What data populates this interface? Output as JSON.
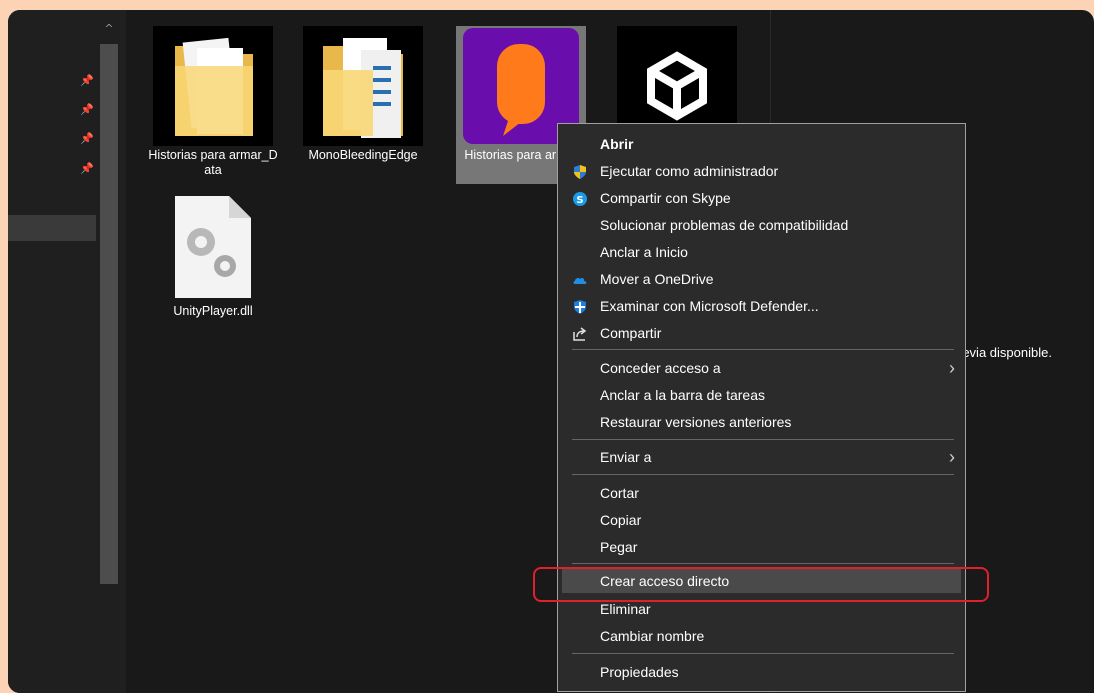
{
  "files": [
    {
      "label": "Historias para armar_Data",
      "icon": "folder-icon"
    },
    {
      "label": "MonoBleedingEdge",
      "icon": "folder-documents-icon"
    },
    {
      "label": "Historias para armar",
      "icon": "app-speech-bubble-icon",
      "selected": true
    },
    {
      "label": "",
      "icon": "unity-logo-icon"
    },
    {
      "label": "UnityPlayer.dll",
      "icon": "dll-gears-icon"
    }
  ],
  "preview": {
    "text": "revia disponible."
  },
  "menu": {
    "items": [
      {
        "label": "Abrir",
        "bold": true
      },
      {
        "label": "Ejecutar como administrador",
        "icon": "uac-shield-icon"
      },
      {
        "label": "Compartir con Skype",
        "icon": "skype-icon"
      },
      {
        "label": "Solucionar problemas de compatibilidad"
      },
      {
        "label": "Anclar a Inicio"
      },
      {
        "label": "Mover a OneDrive",
        "icon": "onedrive-cloud-icon"
      },
      {
        "label": "Examinar con Microsoft Defender...",
        "icon": "defender-shield-icon"
      },
      {
        "label": "Compartir",
        "icon": "share-icon"
      },
      {
        "label": "Conceder acceso a",
        "submenu": true
      },
      {
        "label": "Anclar a la barra de tareas"
      },
      {
        "label": "Restaurar versiones anteriores"
      },
      {
        "label": "Enviar a",
        "submenu": true
      },
      {
        "label": "Cortar"
      },
      {
        "label": "Copiar"
      },
      {
        "label": "Pegar"
      },
      {
        "label": "Crear acceso directo",
        "highlighted": true
      },
      {
        "label": "Eliminar"
      },
      {
        "label": "Cambiar nombre"
      },
      {
        "label": "Propiedades"
      }
    ],
    "submenu_arrow": "›"
  },
  "colors": {
    "page_bg": "#fcd3b5",
    "window_bg": "#191919",
    "menu_bg": "#2b2b2b",
    "highlight_outline": "#e0202a",
    "app_icon_bg": "#6a0dad",
    "app_icon_bubble": "#ff7a1a"
  }
}
